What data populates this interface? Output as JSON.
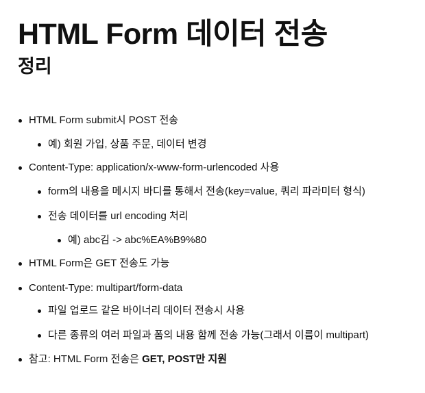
{
  "heading": {
    "title": "HTML Form 데이터 전송",
    "subtitle": "정리"
  },
  "bullets": [
    {
      "text": "HTML Form submit시 POST 전송"
    },
    {
      "text": "예) 회원 가입, 상품 주문, 데이터 변경"
    },
    {
      "text": "Content-Type: application/x-www-form-urlencoded 사용"
    },
    {
      "text": "form의 내용을 메시지 바디를 통해서 전송(key=value, 쿼리 파라미터 형식)"
    },
    {
      "text": "전송 데이터를 url encoding 처리"
    },
    {
      "text": "예) abc김 -> abc%EA%B9%80"
    },
    {
      "text": "HTML Form은 GET 전송도 가능"
    },
    {
      "text": "Content-Type: multipart/form-data"
    },
    {
      "text": "파일 업로드 같은 바이너리 데이터 전송시 사용"
    },
    {
      "text": "다른 종류의 여러 파일과 폼의 내용 함께 전송 가능(그래서 이름이 multipart)"
    },
    {
      "text": "참고: HTML Form 전송은 ",
      "bold": "GET, POST만 지원"
    }
  ]
}
